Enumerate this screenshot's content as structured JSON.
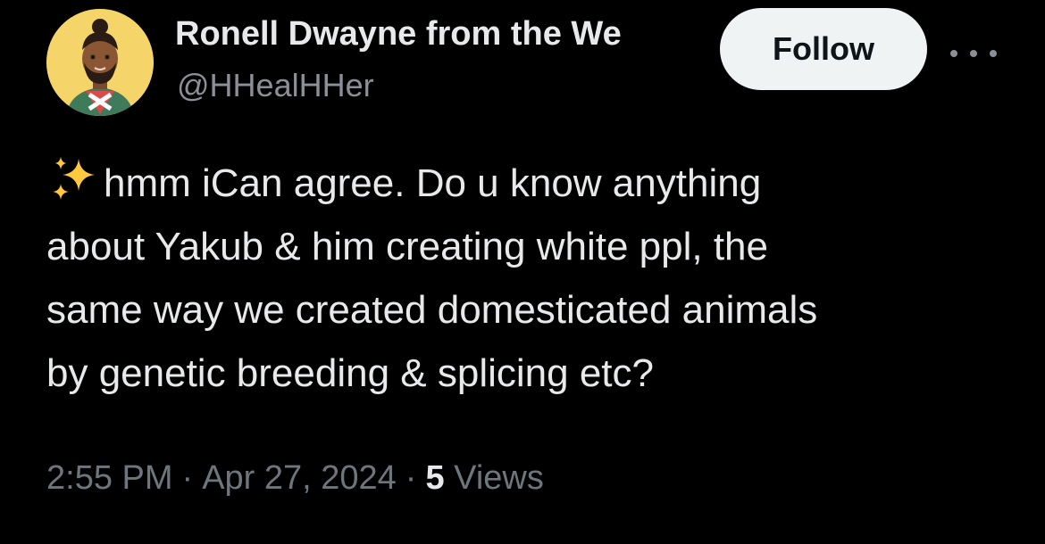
{
  "author": {
    "display_name": "Ronell Dwayne from the We",
    "handle": "@HHealHHer",
    "avatar_icon": "memoji-avatar"
  },
  "actions": {
    "follow_label": "Follow",
    "more_icon": "more-dots-icon"
  },
  "tweet": {
    "emoji_icon": "sparkles-icon",
    "lines": [
      "hmm iCan agree. Do u know anything",
      "about Yakub & him creating white ppl, the",
      "same way we created domesticated animals",
      "by genetic breeding & splicing etc?"
    ]
  },
  "meta": {
    "time": "2:55 PM",
    "separator": "·",
    "date": "Apr 27, 2024",
    "views_count": "5",
    "views_label": "Views"
  },
  "colors": {
    "background": "#000000",
    "text_primary": "#e7e9ea",
    "text_secondary": "#6e767d",
    "follow_bg": "#eff3f4",
    "avatar_bg": "#f5d46a",
    "sparkle": "#ffc83d"
  }
}
